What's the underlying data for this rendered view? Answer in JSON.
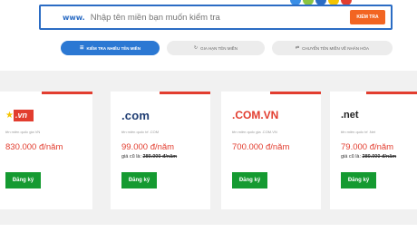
{
  "search": {
    "prefix": "www.",
    "placeholder": "Nhập tên miền bạn muốn kiểm tra",
    "button_label": "KIỂM TRA"
  },
  "tabs": [
    {
      "label": "KIỂM TRA NHIỀU TÊN MIỀN",
      "icon": "list-icon",
      "active": true
    },
    {
      "label": "GIA HẠN TÊN MIỀN",
      "icon": "refresh-icon",
      "active": false
    },
    {
      "label": "CHUYỂN TÊN MIỀN VỀ NHÂN HÒA",
      "icon": "transfer-icon",
      "active": false
    }
  ],
  "cards": [
    {
      "logo_text": ".vn",
      "description": "tên miền quốc gia VN",
      "price": "830.000 đ/năm",
      "old_price_label": "",
      "old_price": "",
      "register_label": "Đăng ký"
    },
    {
      "logo_text": ".com",
      "description": "tên miền quốc tế .COM",
      "price": "99.000 đ/năm",
      "old_price_label": "giá cũ là:",
      "old_price": "280.000 đ/năm",
      "register_label": "Đăng ký"
    },
    {
      "logo_text": ".COM.VN",
      "description": "tên miền quốc gia .COM.VN",
      "price": "700.000 đ/năm",
      "old_price_label": "",
      "old_price": "",
      "register_label": "Đăng ký"
    },
    {
      "logo_text": ".net",
      "description": "tên miền quốc tế .Net",
      "price": "79.000 đ/năm",
      "old_price_label": "giá cũ là:",
      "old_price": "280.000 đ/năm",
      "register_label": "Đăng ký"
    }
  ],
  "colors": {
    "accent_blue": "#2b78d3",
    "price_red": "#e23d2f",
    "register_green": "#159a31",
    "search_button_orange": "#f26522"
  }
}
